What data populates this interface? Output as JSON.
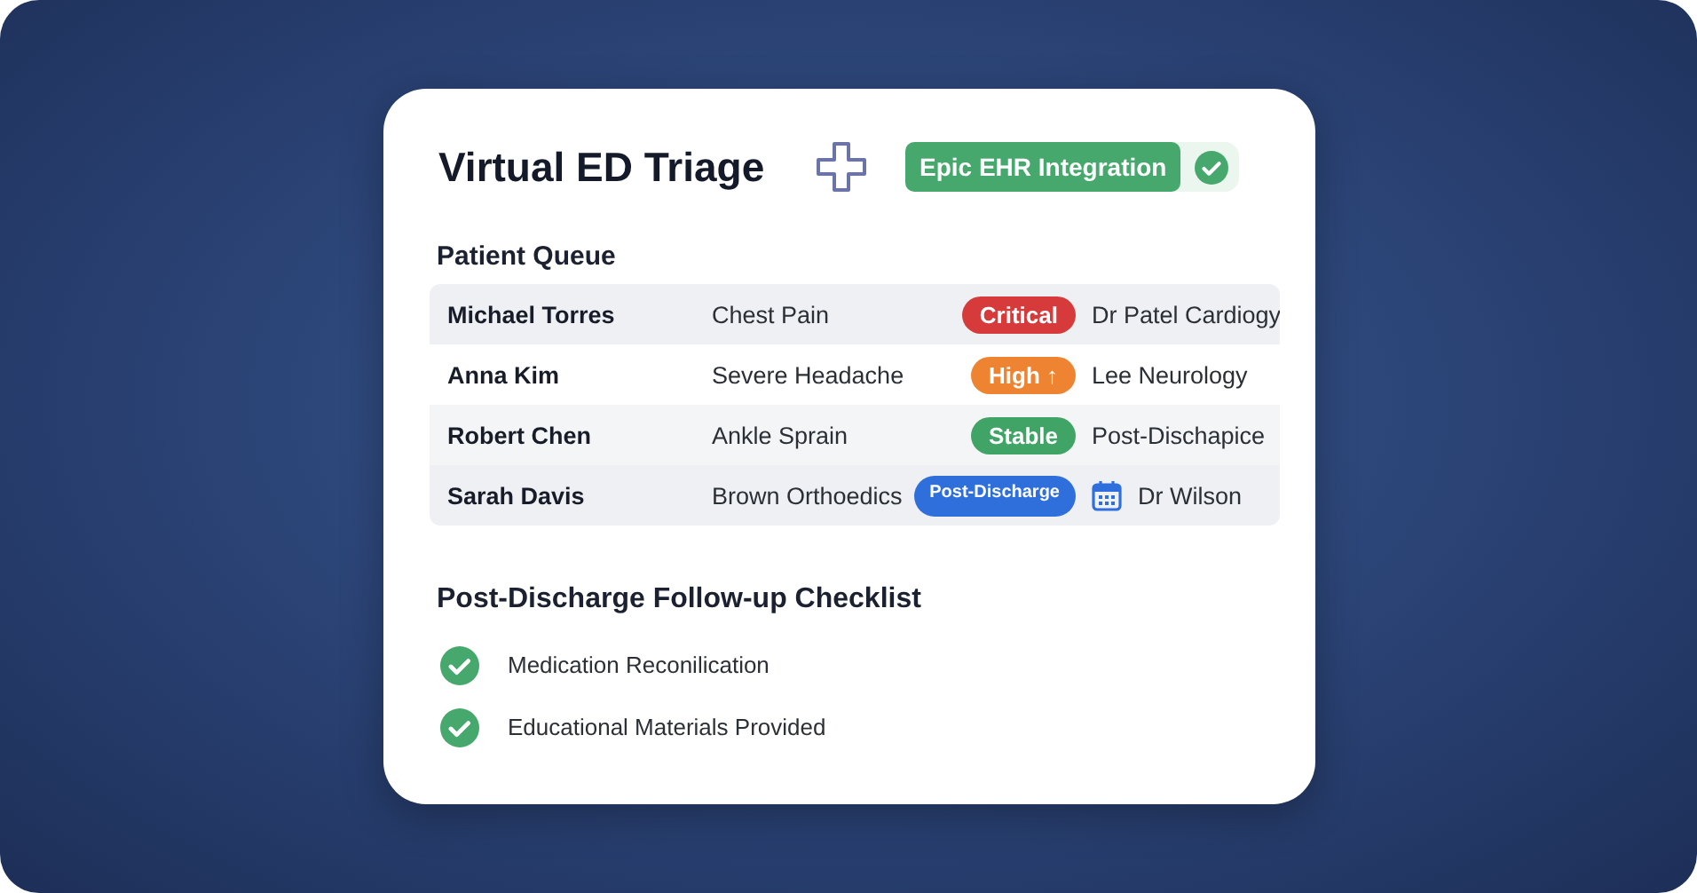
{
  "card": {
    "title": "Virtual ED Triage",
    "integration": {
      "label": "Epic EHR Integration",
      "checked": true
    }
  },
  "queue": {
    "title": "Patient Queue",
    "rows": [
      {
        "name": "Michael Torres",
        "complaint": "Chest Pain",
        "badge": {
          "label": "Critical",
          "color": "#d63a3a",
          "kind": "large"
        },
        "doctor": "Dr Patel Cardiogy",
        "kind": "standard"
      },
      {
        "name": "Anna Kim",
        "complaint": "Severe Headache",
        "badge": {
          "label": "High ↑",
          "color": "#ee8432",
          "kind": "large"
        },
        "doctor": "Lee Neurology",
        "kind": "standard"
      },
      {
        "name": "Robert Chen",
        "complaint": "Ankle Sprain",
        "badge": {
          "label": "Stable",
          "color": "#3fa466",
          "kind": "large"
        },
        "doctor": "Post-Dischapice",
        "kind": "standard"
      },
      {
        "name": "Sarah Davis",
        "complaint": "Brown Orthoedics",
        "badge": {
          "label": "Post-Discharge",
          "color": "#2f6fdc",
          "kind": "small"
        },
        "doctor": "Dr Wilson",
        "kind": "scheduled"
      }
    ]
  },
  "checklist": {
    "title": "Post-Discharge Follow-up Checklist",
    "items": [
      {
        "label": "Medication Reconilication",
        "checked": true
      },
      {
        "label": "Educational Materials Provided",
        "checked": true
      }
    ]
  }
}
